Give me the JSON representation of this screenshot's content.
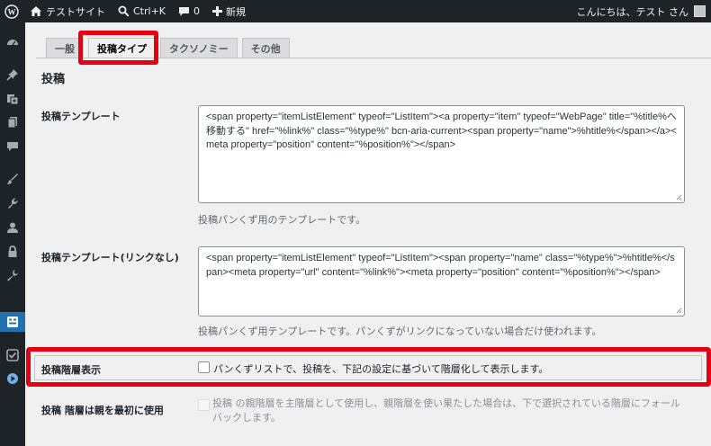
{
  "adminbar": {
    "site_name": "テストサイト",
    "search_shortcut": "Ctrl+K",
    "comments_count": "0",
    "new_label": "新規",
    "greeting": "こんにちは、テスト さん"
  },
  "tabs": [
    {
      "label": "一般"
    },
    {
      "label": "投稿タイプ"
    },
    {
      "label": "タクソノミー"
    },
    {
      "label": "その他"
    }
  ],
  "section_title": "投稿",
  "fields": {
    "post_template": {
      "label": "投稿テンプレート",
      "value": "<span property=\"itemListElement\" typeof=\"ListItem\"><a property=\"item\" typeof=\"WebPage\" title=\"%title%へ移動する\" href=\"%link%\" class=\"%type%\" bcn-aria-current><span property=\"name\">%htitle%</span></a><meta property=\"position\" content=\"%position%\"></span>",
      "description": "投稿パンくず用のテンプレートです。"
    },
    "post_template_unlinked": {
      "label": "投稿テンプレート(リンクなし)",
      "value": "<span property=\"itemListElement\" typeof=\"ListItem\"><span property=\"name\" class=\"%type%\">%htitle%</span><meta property=\"url\" content=\"%link%\"><meta property=\"position\" content=\"%position%\"></span>",
      "description": "投稿パンくず用テンプレートです。パンくずがリンクになっていない場合だけ使われます。"
    },
    "post_hierarchy": {
      "label": "投稿階層表示",
      "checkbox_label": "パンくずリストで、投稿を、下記の設定に基づいて階層化して表示します。"
    },
    "post_parent_first": {
      "label": "投稿 階層は親を最初に使用",
      "checkbox_label": "投稿 の親階層を主階層として使用し、親階層を使い果たした場合は、下で選択されている階層にフォールバックします。"
    }
  },
  "colors": {
    "highlight": "#e60012",
    "adminbar_bg": "#1d2327",
    "menu_current": "#2271b1"
  }
}
